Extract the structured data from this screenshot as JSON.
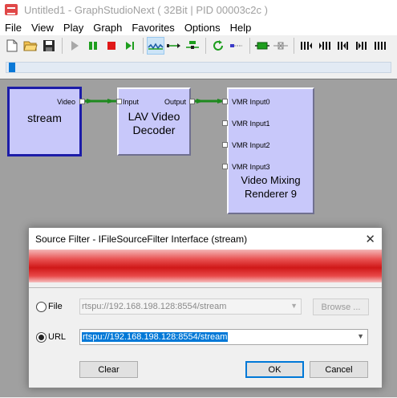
{
  "window": {
    "title": "Untitled1 - GraphStudioNext ( 32Bit | PID 00003c2c )"
  },
  "menu": [
    "File",
    "View",
    "Play",
    "Graph",
    "Favorites",
    "Options",
    "Help"
  ],
  "filters": {
    "source": {
      "name": "stream",
      "output_pin": "Video"
    },
    "decoder": {
      "name_line1": "LAV Video",
      "name_line2": "Decoder",
      "input_pin": "Input",
      "output_pin": "Output"
    },
    "renderer": {
      "name_line1": "Video Mixing",
      "name_line2": "Renderer 9",
      "pins": [
        "VMR Input0",
        "VMR Input1",
        "VMR Input2",
        "VMR Input3"
      ]
    }
  },
  "dialog": {
    "title": "Source Filter - IFileSourceFilter Interface (stream)",
    "close_glyph": "✕",
    "file": {
      "label": "File",
      "value": "rtspu://192.168.198.128:8554/stream",
      "selected": false
    },
    "browse_label": "Browse ...",
    "url": {
      "label": "URL",
      "value": "rtspu://192.168.198.128:8554/stream",
      "selected": true
    },
    "clear_label": "Clear",
    "ok_label": "OK",
    "cancel_label": "Cancel"
  },
  "colors": {
    "filter_fill": "#c8c8fa",
    "selected_border": "#1c1ca8",
    "connection": "#1e8a1e",
    "canvas": "#a0a0a0"
  }
}
